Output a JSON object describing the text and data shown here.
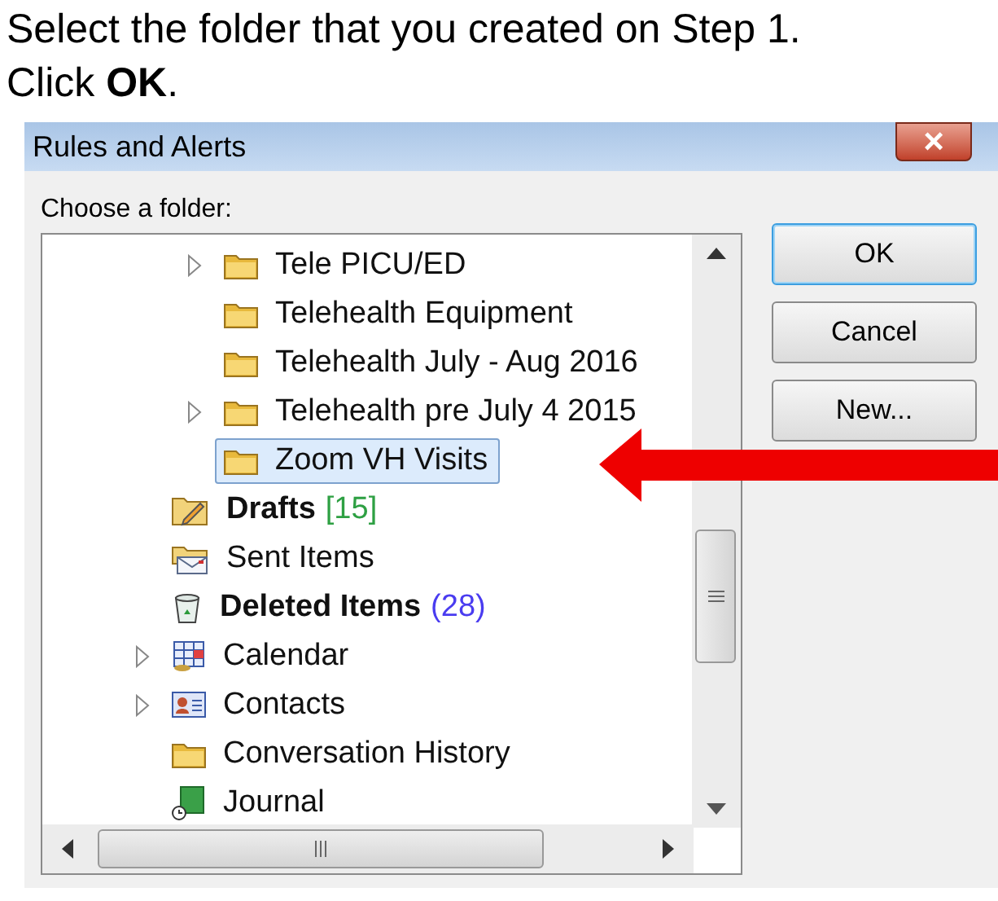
{
  "instruction": {
    "line_1": "Select the folder that you created on Step 1.",
    "line_2": "Click **OK**."
  },
  "window": {
    "title": "Rules and Alerts",
    "close": "×"
  },
  "prompt": "Choose a folder:",
  "tree": {
    "nested_items": [
      {
        "label": "Tele PICU/ED",
        "kind": "folder",
        "expandable": true,
        "selected": false
      },
      {
        "label": "Telehealth Equipment",
        "kind": "folder",
        "expandable": false,
        "selected": false
      },
      {
        "label": "Telehealth July - Aug 2016",
        "kind": "folder",
        "expandable": false,
        "selected": false
      },
      {
        "label": "Telehealth pre July 4 2015",
        "kind": "folder",
        "expandable": true,
        "selected": false
      },
      {
        "label": "Zoom VH Visits",
        "kind": "folder",
        "expandable": false,
        "selected": true
      }
    ],
    "items": [
      {
        "label": "Drafts",
        "kind": "drafts",
        "bold": true,
        "count": {
          "text": "[15]",
          "color": "#2ea043"
        },
        "expandable": false,
        "selected": false
      },
      {
        "label": "Sent Items",
        "kind": "sent",
        "bold": false,
        "expandable": false,
        "selected": false
      },
      {
        "label": "Deleted Items",
        "kind": "deleted",
        "bold": true,
        "count": {
          "text": "(28)",
          "color": "#4a3cf0"
        },
        "expandable": false,
        "selected": false
      },
      {
        "label": "Calendar",
        "kind": "calendar",
        "bold": false,
        "expandable": true,
        "selected": false
      },
      {
        "label": "Contacts",
        "kind": "contacts",
        "bold": false,
        "expandable": true,
        "selected": false
      },
      {
        "label": "Conversation History",
        "kind": "folder",
        "bold": false,
        "expandable": false,
        "selected": false
      },
      {
        "label": "Journal",
        "kind": "journal",
        "bold": false,
        "expandable": false,
        "selected": false
      }
    ]
  },
  "buttons": [
    {
      "label": "OK",
      "default": true
    },
    {
      "label": "Cancel",
      "default": false
    },
    {
      "label": "New...",
      "default": false
    }
  ]
}
